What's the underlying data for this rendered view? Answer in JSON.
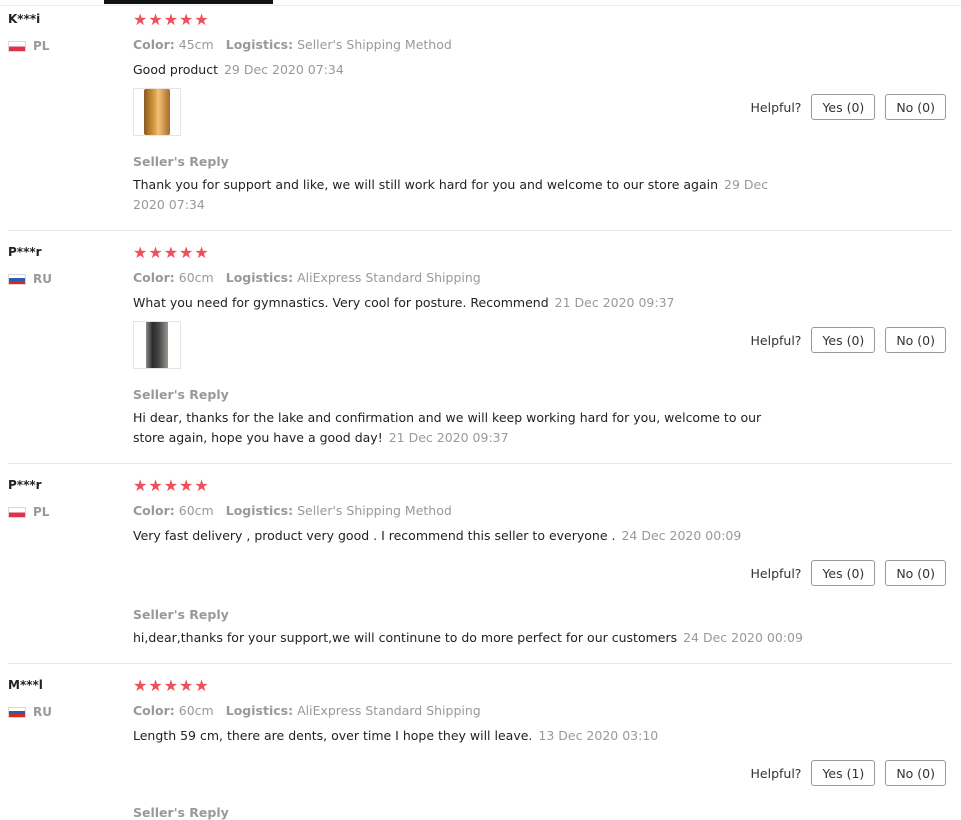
{
  "labels": {
    "color": "Color:",
    "logistics": "Logistics:",
    "helpful": "Helpful?",
    "seller_reply": "Seller's Reply"
  },
  "reviews": [
    {
      "user": "K***i",
      "country": "PL",
      "rating": 5,
      "color": "45cm",
      "logistics": "Seller's Shipping Method",
      "text": "Good product",
      "date": "29 Dec 2020 07:34",
      "has_image": true,
      "yes": "Yes (0)",
      "no": "No (0)",
      "reply": "Thank you for support and like, we will still work hard for you and welcome to our store again",
      "reply_date": "29 Dec 2020 07:34"
    },
    {
      "user": "P***r",
      "country": "RU",
      "rating": 5,
      "color": "60cm",
      "logistics": "AliExpress Standard Shipping",
      "text": "What you need for gymnastics. Very cool for posture. Recommend",
      "date": "21 Dec 2020 09:37",
      "has_image": true,
      "yes": "Yes (0)",
      "no": "No (0)",
      "reply": "Hi dear, thanks for the lake and confirmation and we will keep working hard for you, welcome to our store again, hope you have a good day!",
      "reply_date": "21 Dec 2020 09:37"
    },
    {
      "user": "P***r",
      "country": "PL",
      "rating": 5,
      "color": "60cm",
      "logistics": "Seller's Shipping Method",
      "text": "Very fast delivery , product very good . I recommend this seller to everyone .",
      "date": "24 Dec 2020 00:09",
      "has_image": false,
      "yes": "Yes (0)",
      "no": "No (0)",
      "reply": "hi,dear,thanks for your support,we will continune to do more perfect for our customers",
      "reply_date": "24 Dec 2020 00:09"
    },
    {
      "user": "M***l",
      "country": "RU",
      "rating": 5,
      "color": "60cm",
      "logistics": "AliExpress Standard Shipping",
      "text": "Length 59 cm, there are dents, over time I hope they will leave.",
      "date": "13 Dec 2020 03:10",
      "has_image": false,
      "yes": "Yes (1)",
      "no": "No (0)"
    }
  ],
  "colors": {
    "star": "#f0505a",
    "muted": "#999999",
    "text": "#222222"
  }
}
